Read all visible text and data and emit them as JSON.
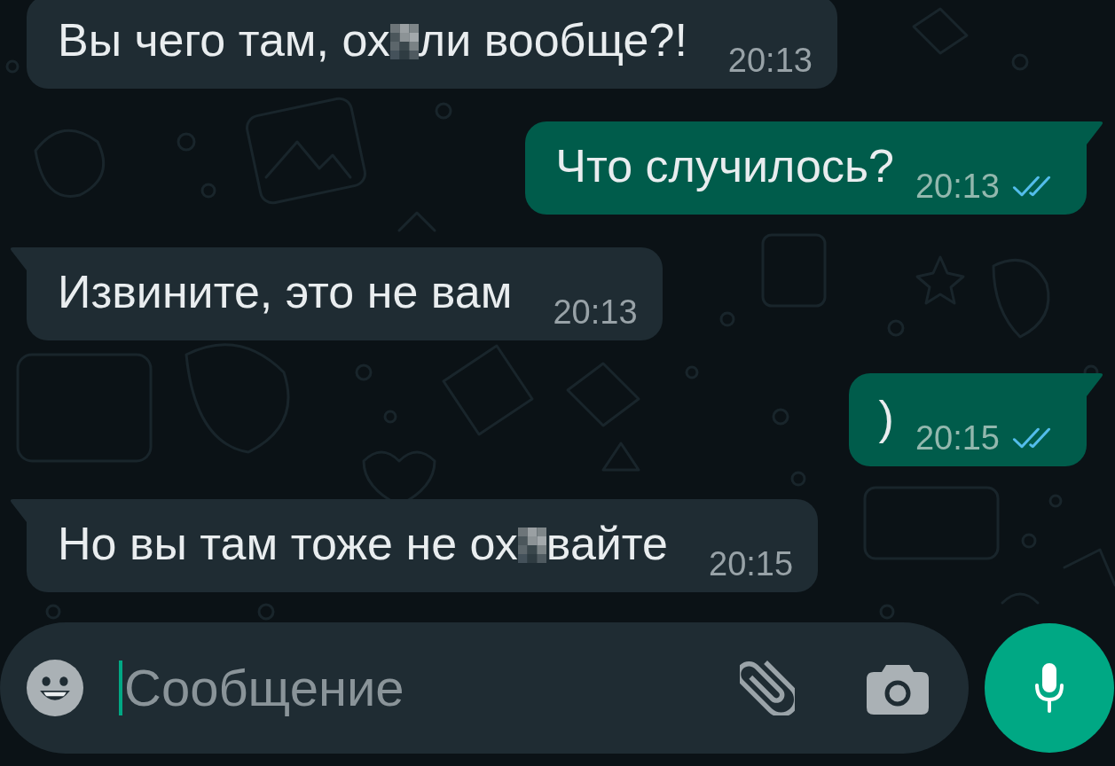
{
  "messages": [
    {
      "kind": "incoming",
      "tail": false,
      "parts": [
        {
          "kind": "text",
          "text": "Вы чего там, ох"
        },
        {
          "kind": "censored"
        },
        {
          "kind": "text",
          "text": "ли вообще?!"
        }
      ],
      "time": "20:13"
    },
    {
      "kind": "outgoing",
      "tail": true,
      "parts": [
        {
          "kind": "text",
          "text": "Что случилось?"
        }
      ],
      "time": "20:13",
      "read": true
    },
    {
      "kind": "incoming",
      "tail": true,
      "parts": [
        {
          "kind": "text",
          "text": "Извините, это не вам"
        }
      ],
      "time": "20:13"
    },
    {
      "kind": "outgoing",
      "tail": true,
      "parts": [
        {
          "kind": "text",
          "text": ")"
        }
      ],
      "time": "20:15",
      "read": true
    },
    {
      "kind": "incoming",
      "tail": true,
      "parts": [
        {
          "kind": "text",
          "text": "Но вы там тоже не ох"
        },
        {
          "kind": "censored"
        },
        {
          "kind": "text",
          "text": "вайте"
        }
      ],
      "time": "20:15"
    }
  ],
  "composer": {
    "placeholder": "Сообщение",
    "focused": true
  }
}
